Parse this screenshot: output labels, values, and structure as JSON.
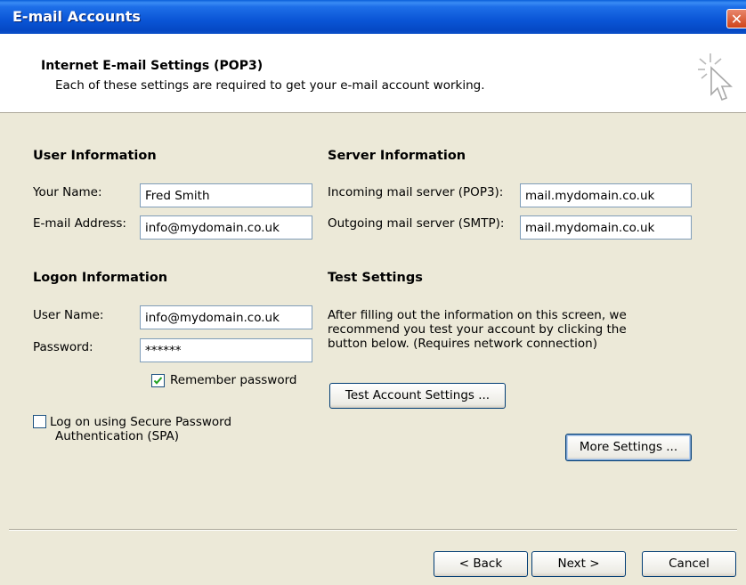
{
  "window": {
    "title": "E-mail Accounts",
    "close_glyph": "✕"
  },
  "header": {
    "title": "Internet E-mail Settings (POP3)",
    "subtitle": "Each of these settings are required to get your e-mail account working."
  },
  "user_info": {
    "heading": "User Information",
    "name_label": "Your Name:",
    "name_value": "Fred Smith",
    "email_label": "E-mail Address:",
    "email_value": "info@mydomain.co.uk"
  },
  "server_info": {
    "heading": "Server Information",
    "incoming_label": "Incoming mail server (POP3):",
    "incoming_value": "mail.mydomain.co.uk",
    "outgoing_label": "Outgoing mail server (SMTP):",
    "outgoing_value": "mail.mydomain.co.uk"
  },
  "logon_info": {
    "heading": "Logon Information",
    "username_label": "User Name:",
    "username_value": "info@mydomain.co.uk",
    "password_label": "Password:",
    "password_value": "******",
    "remember_label": "Remember password",
    "remember_checked": true,
    "spa_label_line1": "Log on using Secure Password",
    "spa_label_line2": "Authentication (SPA)",
    "spa_checked": false
  },
  "test_settings": {
    "heading": "Test Settings",
    "line1": "After filling out the information on this screen, we",
    "line2": "recommend you test your account by clicking the",
    "line3": "button below. (Requires network connection)",
    "test_button": "Test Account Settings ...",
    "more_button": "More Settings ..."
  },
  "footer": {
    "back": "< Back",
    "next": "Next >",
    "cancel": "Cancel"
  },
  "colors": {
    "title_bar": "#0a55d6",
    "dialog_bg": "#ece9d8",
    "check_mark": "#21a121",
    "close_button": "#d0441a"
  },
  "icons": {
    "header": "cursor-sparkle-icon",
    "check": "checkmark-icon",
    "close": "close-icon"
  }
}
